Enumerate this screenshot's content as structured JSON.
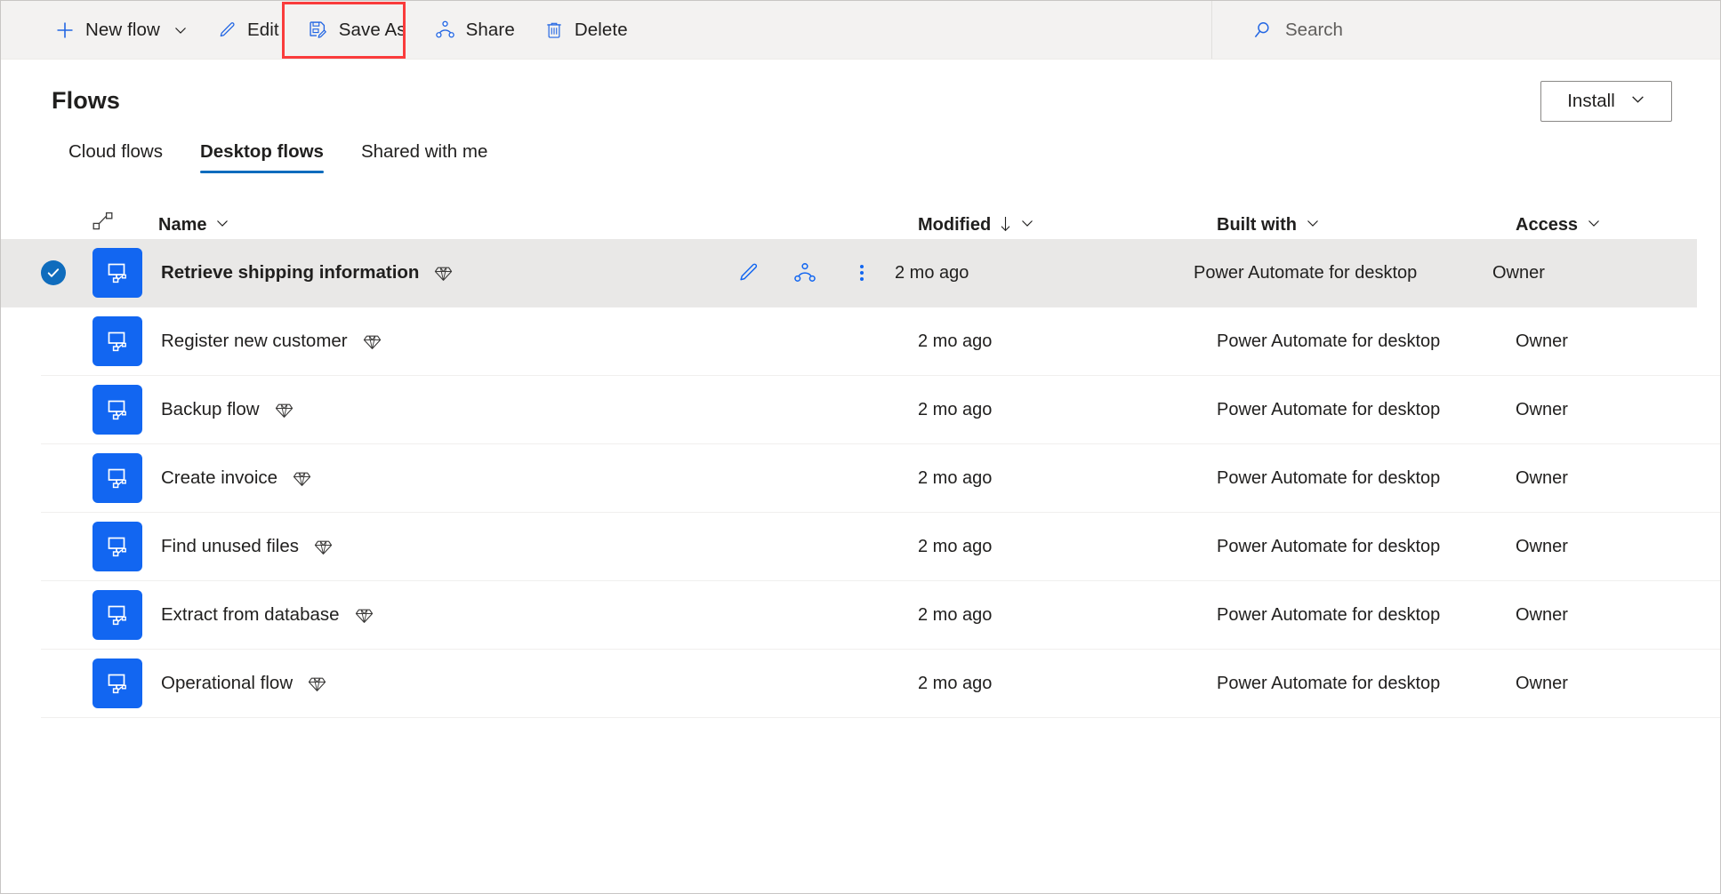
{
  "commandbar": {
    "items": [
      {
        "label": "New flow",
        "icon": "plus-icon",
        "has_chevron": true
      },
      {
        "label": "Edit",
        "icon": "pencil-icon",
        "has_chevron": false
      },
      {
        "label": "Save As",
        "icon": "save-as-icon",
        "has_chevron": false
      },
      {
        "label": "Share",
        "icon": "share-icon",
        "has_chevron": false
      },
      {
        "label": "Delete",
        "icon": "trash-icon",
        "has_chevron": false
      }
    ],
    "search": {
      "label": "Search",
      "icon": "search-icon"
    },
    "highlight": {
      "target": "Save As",
      "color": "#fa3c3c"
    }
  },
  "header": {
    "title": "Flows",
    "install_button": {
      "label": "Install",
      "icon": "chevron-down-icon"
    }
  },
  "tabs": [
    {
      "label": "Cloud flows",
      "active": false
    },
    {
      "label": "Desktop flows",
      "active": true
    },
    {
      "label": "Shared with me",
      "active": false
    }
  ],
  "table": {
    "columns": [
      {
        "label": "",
        "icon": "flow-type-icon",
        "sortable": false
      },
      {
        "label": "Name",
        "icon": "chevron-down-icon",
        "sortable": true
      },
      {
        "label": "Modified",
        "icon": "chevron-down-icon",
        "sort_arrow": "↓",
        "sortable": true
      },
      {
        "label": "Built with",
        "icon": "chevron-down-icon",
        "sortable": true
      },
      {
        "label": "Access",
        "icon": "chevron-down-icon",
        "sortable": true
      }
    ],
    "rows": [
      {
        "name": "Retrieve shipping information",
        "premium": true,
        "modified": "2 mo ago",
        "built_with": "Power Automate for desktop",
        "access": "Owner",
        "selected": true,
        "actions": [
          "edit-icon",
          "share-icon",
          "more-options-icon"
        ]
      },
      {
        "name": "Register new customer",
        "premium": true,
        "modified": "2 mo ago",
        "built_with": "Power Automate for desktop",
        "access": "Owner",
        "selected": false,
        "actions": []
      },
      {
        "name": "Backup flow",
        "premium": true,
        "modified": "2 mo ago",
        "built_with": "Power Automate for desktop",
        "access": "Owner",
        "selected": false,
        "actions": []
      },
      {
        "name": "Create invoice",
        "premium": true,
        "modified": "2 mo ago",
        "built_with": "Power Automate for desktop",
        "access": "Owner",
        "selected": false,
        "actions": []
      },
      {
        "name": "Find unused files",
        "premium": true,
        "modified": "2 mo ago",
        "built_with": "Power Automate for desktop",
        "access": "Owner",
        "selected": false,
        "actions": []
      },
      {
        "name": "Extract from database",
        "premium": true,
        "modified": "2 mo ago",
        "built_with": "Power Automate for desktop",
        "access": "Owner",
        "selected": false,
        "actions": []
      },
      {
        "name": "Operational flow",
        "premium": true,
        "modified": "2 mo ago",
        "built_with": "Power Automate for desktop",
        "access": "Owner",
        "selected": false,
        "actions": []
      }
    ]
  },
  "colors": {
    "accent": "#0f6cbd",
    "icon_blue": "#1266f1",
    "tile_blue": "#1266f1",
    "commandbar_bg": "#f3f2f1",
    "selected_row_bg": "#e9e8e7",
    "highlight_red": "#fa3c3c"
  }
}
